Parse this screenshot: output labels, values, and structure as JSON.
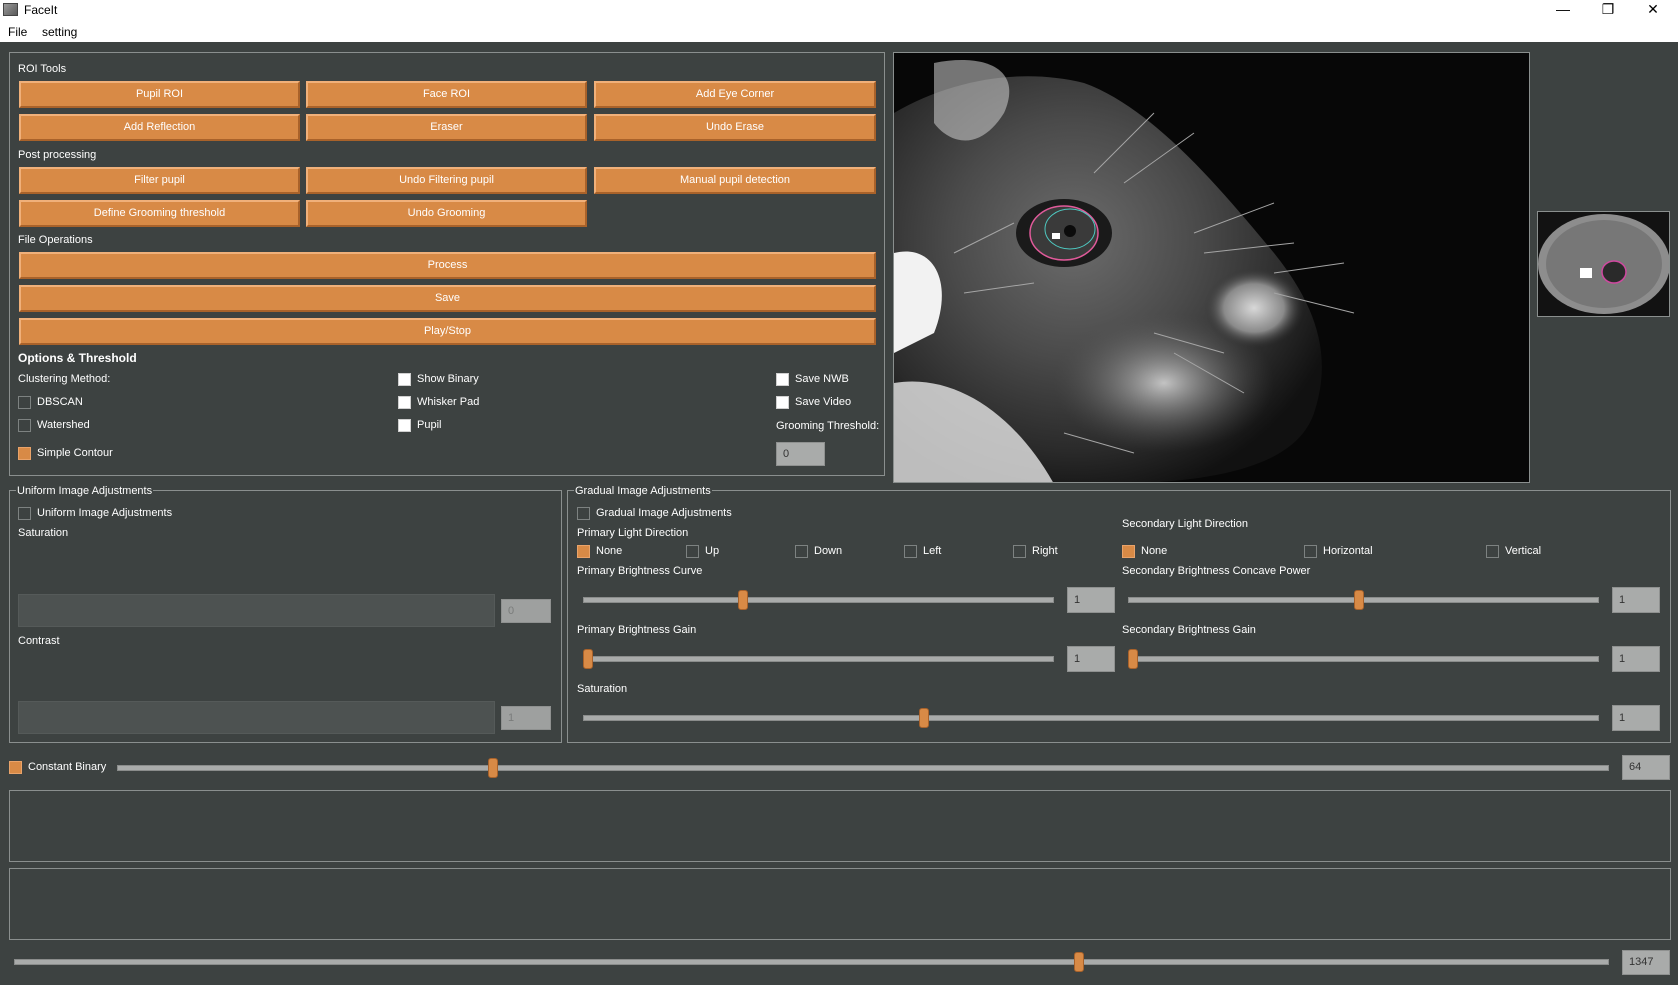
{
  "window": {
    "title": "FaceIt",
    "minimize": "—",
    "restore": "❐",
    "close": "✕"
  },
  "menu": {
    "file": "File",
    "setting": "setting"
  },
  "roi_tools": {
    "title": "ROI Tools",
    "pupil_roi": "Pupil ROI",
    "face_roi": "Face ROI",
    "add_eye_corner": "Add Eye Corner",
    "add_reflection": "Add Reflection",
    "eraser": "Eraser",
    "undo_erase": "Undo Erase"
  },
  "post_processing": {
    "title": "Post processing",
    "filter_pupil": "Filter pupil",
    "undo_filtering_pupil": "Undo Filtering pupil",
    "manual_pupil_detection": "Manual pupil detection",
    "define_grooming_threshold": "Define Grooming threshold",
    "undo_grooming": "Undo Grooming"
  },
  "file_operations": {
    "title": "File Operations",
    "process": "Process",
    "save": "Save",
    "play_stop": "Play/Stop"
  },
  "options": {
    "title": "Options & Threshold",
    "clustering_method": "Clustering Method:",
    "dbscan": "DBSCAN",
    "watershed": "Watershed",
    "simple_contour": "Simple Contour",
    "show_binary": "Show Binary",
    "whisker_pad": "Whisker Pad",
    "pupil": "Pupil",
    "save_nwb": "Save NWB",
    "save_video": "Save Video",
    "grooming_threshold_label": "Grooming Threshold:",
    "grooming_threshold_value": "0"
  },
  "uniform": {
    "title": "Uniform Image Adjustments",
    "checkbox": "Uniform Image Adjustments",
    "saturation": "Saturation",
    "saturation_value": "0",
    "contrast": "Contrast",
    "contrast_value": "1"
  },
  "gradual": {
    "title": "Gradual Image Adjustments",
    "checkbox": "Gradual Image Adjustments",
    "primary_light_direction": "Primary Light Direction",
    "primary_dirs": [
      "None",
      "Up",
      "Down",
      "Left",
      "Right"
    ],
    "secondary_light_direction": "Secondary Light Direction",
    "secondary_dirs": [
      "None",
      "Horizontal",
      "Vertical"
    ],
    "primary_brightness_curve": "Primary Brightness Curve",
    "primary_brightness_curve_value": "1",
    "primary_brightness_curve_level": 0.34,
    "secondary_brightness_concave_power": "Secondary Brightness Concave Power",
    "secondary_brightness_concave_power_value": "1",
    "secondary_brightness_concave_power_level": 0.49,
    "primary_brightness_gain": "Primary Brightness Gain",
    "primary_brightness_gain_value": "1",
    "primary_brightness_gain_level": 0.01,
    "secondary_brightness_gain": "Secondary Brightness Gain",
    "secondary_brightness_gain_value": "1",
    "secondary_brightness_gain_level": 0.01,
    "saturation": "Saturation",
    "saturation_value": "1",
    "saturation_level": 0.336
  },
  "binary": {
    "label": "Constant Binary",
    "value": "64",
    "level": 0.252
  },
  "frame": {
    "value": "1347",
    "level": 0.668
  },
  "colors": {
    "accent": "#d88a46",
    "background": "#3d4241"
  }
}
